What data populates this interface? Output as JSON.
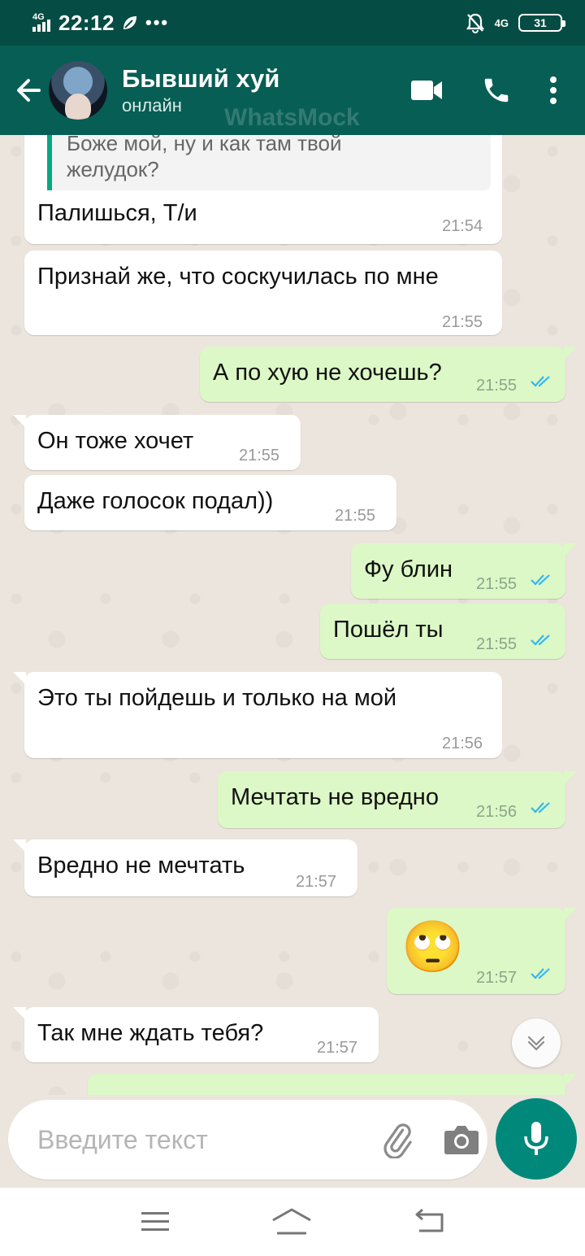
{
  "status_bar": {
    "network_left": "4G",
    "time": "22:12",
    "dots": "•••",
    "network_right": "4G",
    "battery": "31"
  },
  "header": {
    "contact_name": "Бывший хуй",
    "contact_status": "онлайн",
    "watermark": "WhatsMock"
  },
  "chat": {
    "quote_text_1": "Боже мой, ну и как там твой",
    "quote_text_2": "желудок?",
    "messages": [
      {
        "dir": "in",
        "text": "Палишься, Т/и",
        "time": "21:54"
      },
      {
        "dir": "in",
        "text": "Признай же, что соскучилась по мне",
        "time": "21:55"
      },
      {
        "dir": "out",
        "text": "А по хую не хочешь?",
        "time": "21:55"
      },
      {
        "dir": "in",
        "text": "Он тоже хочет",
        "time": "21:55"
      },
      {
        "dir": "in",
        "text": "Даже голосок подал))",
        "time": "21:55"
      },
      {
        "dir": "out",
        "text": "Фу блин",
        "time": "21:55"
      },
      {
        "dir": "out",
        "text": "Пошёл ты",
        "time": "21:55"
      },
      {
        "dir": "in",
        "text": "Это ты пойдешь и только на мой",
        "time": "21:56"
      },
      {
        "dir": "out",
        "text": "Мечтать не вредно",
        "time": "21:56"
      },
      {
        "dir": "in",
        "text": "Вредно не мечтать",
        "time": "21:57"
      },
      {
        "dir": "out",
        "text": "🙄",
        "time": "21:57"
      },
      {
        "dir": "in",
        "text": "Так мне ждать тебя?",
        "time": "21:57"
      }
    ]
  },
  "input": {
    "placeholder": "Введите текст"
  },
  "colors": {
    "header": "#075e54",
    "status_bar": "#054d44",
    "incoming_bubble": "#ffffff",
    "outgoing_bubble": "#dcf8c6",
    "chat_bg": "#ece5dd",
    "mic_button": "#00897b",
    "read_ticks": "#34b7f1"
  },
  "icons": {
    "back": "arrow-left-icon",
    "video": "video-camera-icon",
    "call": "phone-icon",
    "menu": "more-vertical-icon",
    "emoji": "emoji-icon",
    "attach": "paperclip-icon",
    "camera": "camera-icon",
    "mic": "microphone-icon",
    "scroll": "chevron-down-icon"
  }
}
